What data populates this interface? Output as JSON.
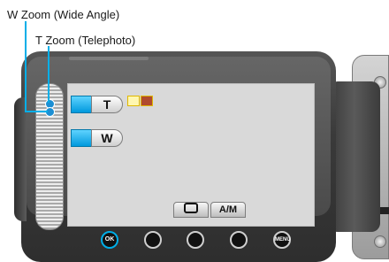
{
  "callouts": {
    "w_zoom": "W Zoom (Wide Angle)",
    "t_zoom": "T Zoom (Telephoto)"
  },
  "screen": {
    "t_button": "T",
    "w_button": "W",
    "playback_icon": "playback-icon",
    "auto_manual": "A/M"
  },
  "controls": {
    "ok_label": "OK",
    "menu_label": "MENU"
  },
  "colors": {
    "accent": "#00aee8",
    "body": "#3a3a3a",
    "screen": "#d9d9d9"
  }
}
